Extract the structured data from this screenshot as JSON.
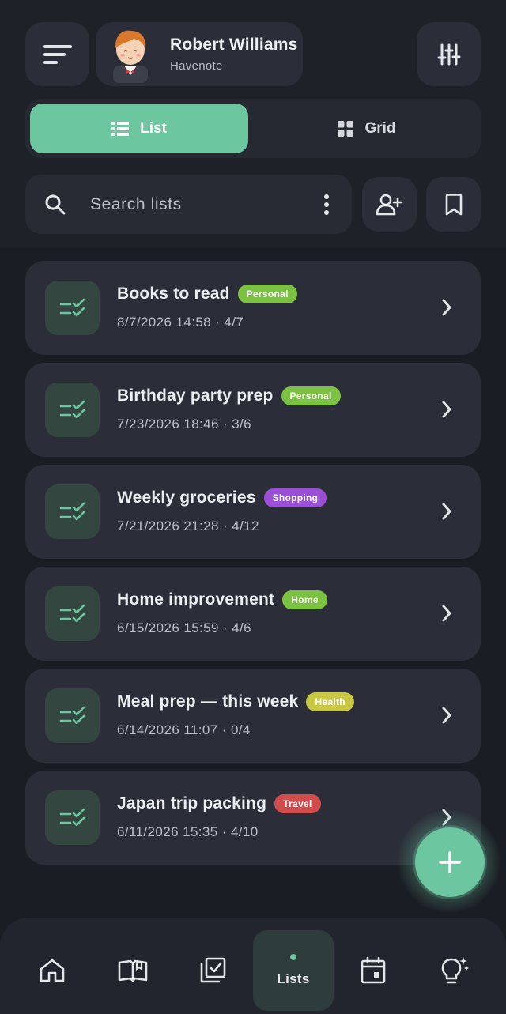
{
  "user": {
    "name": "Robert Williams",
    "app": "Havenote"
  },
  "view_toggle": {
    "list_label": "List",
    "grid_label": "Grid",
    "selected": "List"
  },
  "search": {
    "placeholder": "Search lists"
  },
  "lists": [
    {
      "title": "Books to read",
      "tag": "Personal",
      "tag_color": "#7cc242",
      "meta": "8/7/2026 14:58 · 4/7"
    },
    {
      "title": "Birthday party prep",
      "tag": "Personal",
      "tag_color": "#7cc242",
      "meta": "7/23/2026 18:46 · 3/6"
    },
    {
      "title": "Weekly groceries",
      "tag": "Shopping",
      "tag_color": "#9b4fd6",
      "meta": "7/21/2026 21:28 · 4/12"
    },
    {
      "title": "Home improvement",
      "tag": "Home",
      "tag_color": "#7cc242",
      "meta": "6/15/2026 15:59 · 4/6"
    },
    {
      "title": "Meal prep — this week",
      "tag": "Health",
      "tag_color": "#c9c844",
      "meta": "6/14/2026 11:07 · 0/4"
    },
    {
      "title": "Japan trip packing",
      "tag": "Travel",
      "tag_color": "#d24c4c",
      "meta": "6/11/2026 15:35 · 4/10"
    }
  ],
  "nav": {
    "items": [
      "home-icon",
      "book-icon",
      "checklist-icon",
      "Lists",
      "calendar-icon",
      "lightbulb-icon"
    ],
    "active_label": "Lists"
  },
  "colors": {
    "accent": "#6cc7a1",
    "background": "#1b1d24",
    "card": "#2b2e38"
  }
}
